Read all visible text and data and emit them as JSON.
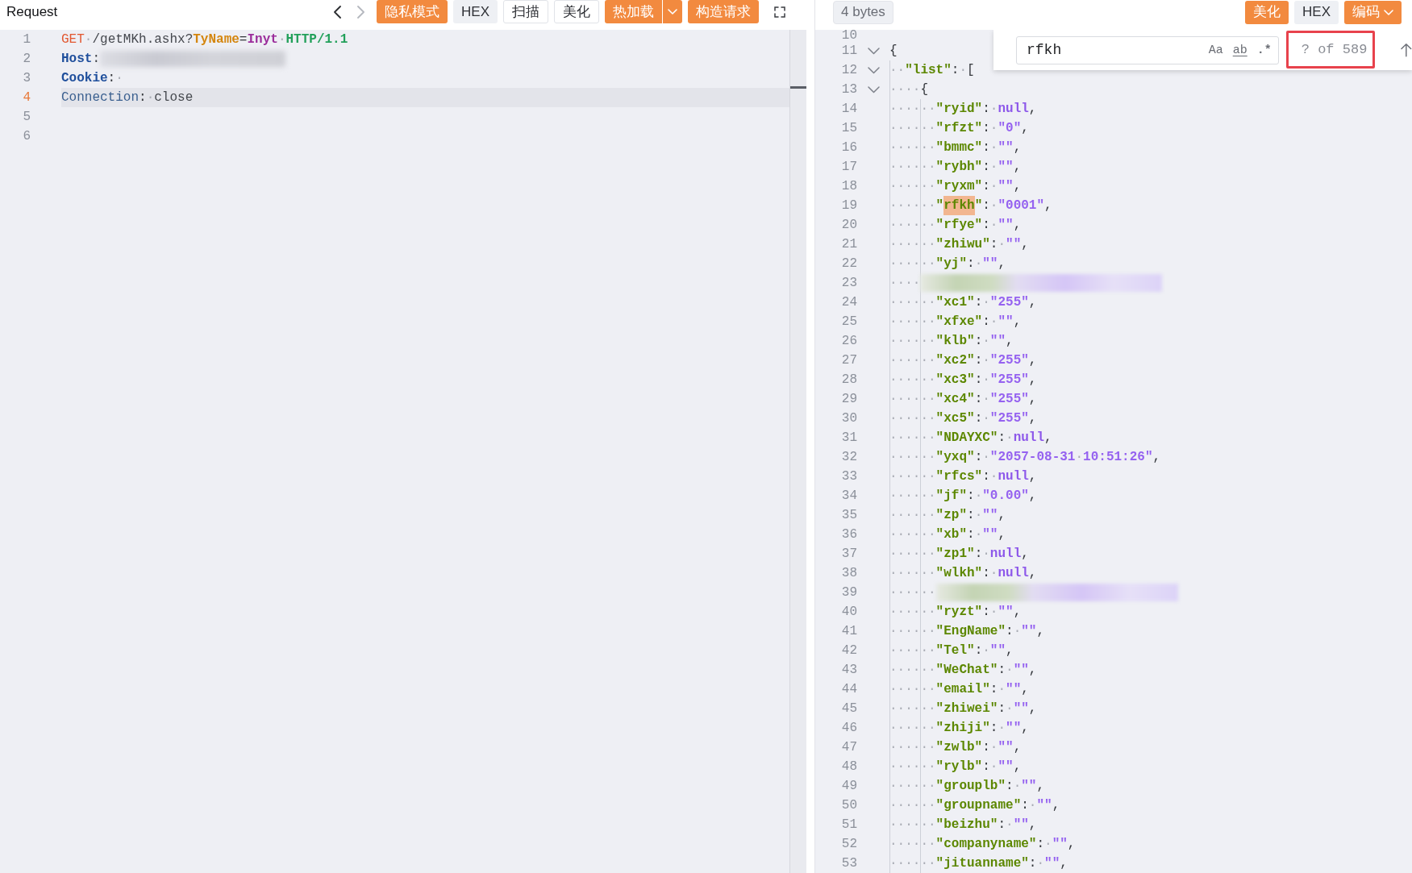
{
  "request": {
    "title": "Request",
    "history_nav": {
      "back_disabled": false,
      "forward_disabled": true
    },
    "toolbar": [
      {
        "label": "隐私模式",
        "kind": "primary",
        "dropdown": false
      },
      {
        "label": "HEX",
        "kind": "muted",
        "dropdown": false
      },
      {
        "label": "扫描",
        "kind": "outline",
        "dropdown": false
      },
      {
        "label": "美化",
        "kind": "outline",
        "dropdown": false
      },
      {
        "label": "热加载",
        "kind": "split",
        "dropdown": true
      },
      {
        "label": "构造请求",
        "kind": "primary",
        "dropdown": false
      }
    ],
    "lines": [
      {
        "number": "1",
        "current": false,
        "tokens": [
          {
            "kind": "method",
            "text": "GET"
          },
          {
            "kind": "ws",
            "text": "·"
          },
          {
            "kind": "path",
            "text": "/getMKh.ashx?"
          },
          {
            "kind": "param",
            "text": "TyName"
          },
          {
            "kind": "punct",
            "text": "="
          },
          {
            "kind": "value",
            "text": "Inyt"
          },
          {
            "kind": "ws",
            "text": "·"
          },
          {
            "kind": "version",
            "text": "HTTP/1.1"
          }
        ]
      },
      {
        "number": "2",
        "current": false,
        "tokens": [
          {
            "kind": "header",
            "text": "Host"
          },
          {
            "kind": "punct",
            "text": ":"
          },
          {
            "kind": "redacted"
          }
        ]
      },
      {
        "number": "3",
        "current": false,
        "tokens": [
          {
            "kind": "header",
            "text": "Cookie"
          },
          {
            "kind": "punct",
            "text": ":"
          },
          {
            "kind": "ws",
            "text": "·"
          }
        ]
      },
      {
        "number": "4",
        "current": true,
        "tokens": [
          {
            "kind": "name",
            "text": "Connection"
          },
          {
            "kind": "punct",
            "text": ":"
          },
          {
            "kind": "ws",
            "text": "·"
          },
          {
            "kind": "path",
            "text": "close"
          }
        ]
      },
      {
        "number": "5",
        "current": false
      },
      {
        "number": "6",
        "current": false
      }
    ]
  },
  "response": {
    "size_badge": "4 bytes",
    "toolbar": [
      {
        "label": "美化",
        "kind": "primary",
        "dropdown": false
      },
      {
        "label": "HEX",
        "kind": "muted",
        "dropdown": false
      },
      {
        "label": "编码",
        "kind": "primary",
        "dropdown": true
      }
    ],
    "find": {
      "query": "rfkh",
      "options": [
        {
          "kind": "case",
          "label": "Aa"
        },
        {
          "kind": "word",
          "label": "ab"
        },
        {
          "kind": "regex",
          "label": ".*"
        }
      ],
      "count": "? of 589",
      "count_boxed": true
    },
    "lines": [
      {
        "number": "10"
      },
      {
        "number": "11",
        "expanded": true,
        "tokens": [
          {
            "kind": "punct",
            "text": "{"
          }
        ]
      },
      {
        "number": "12",
        "expanded": true,
        "tokens": [
          {
            "kind": "ws",
            "text": "··"
          },
          {
            "kind": "key",
            "text": "\"list\""
          },
          {
            "kind": "punct",
            "text": ":"
          },
          {
            "kind": "ws",
            "text": "·"
          },
          {
            "kind": "punct",
            "text": "["
          }
        ]
      },
      {
        "number": "13",
        "expanded": true,
        "tokens": [
          {
            "kind": "ws",
            "text": "····"
          },
          {
            "kind": "punct",
            "text": "{"
          }
        ]
      },
      {
        "number": "14",
        "tokens": [
          {
            "kind": "ws",
            "text": "······"
          },
          {
            "kind": "key",
            "text": "\"ryid\""
          },
          {
            "kind": "punct",
            "text": ":"
          },
          {
            "kind": "ws",
            "text": "·"
          },
          {
            "kind": "null",
            "text": "null"
          },
          {
            "kind": "punct",
            "text": ","
          }
        ]
      },
      {
        "number": "15",
        "tokens": [
          {
            "kind": "ws",
            "text": "······"
          },
          {
            "kind": "key",
            "text": "\"rfzt\""
          },
          {
            "kind": "punct",
            "text": ":"
          },
          {
            "kind": "ws",
            "text": "·"
          },
          {
            "kind": "string",
            "text": "\"0\""
          },
          {
            "kind": "punct",
            "text": ","
          }
        ]
      },
      {
        "number": "16",
        "tokens": [
          {
            "kind": "ws",
            "text": "······"
          },
          {
            "kind": "key",
            "text": "\"bmmc\""
          },
          {
            "kind": "punct",
            "text": ":"
          },
          {
            "kind": "ws",
            "text": "·"
          },
          {
            "kind": "string",
            "text": "\"\""
          },
          {
            "kind": "punct",
            "text": ","
          }
        ]
      },
      {
        "number": "17",
        "tokens": [
          {
            "kind": "ws",
            "text": "······"
          },
          {
            "kind": "key",
            "text": "\"rybh\""
          },
          {
            "kind": "punct",
            "text": ":"
          },
          {
            "kind": "ws",
            "text": "·"
          },
          {
            "kind": "string",
            "text": "\"\""
          },
          {
            "kind": "punct",
            "text": ","
          }
        ]
      },
      {
        "number": "18",
        "tokens": [
          {
            "kind": "ws",
            "text": "······"
          },
          {
            "kind": "key",
            "text": "\"ryxm\""
          },
          {
            "kind": "punct",
            "text": ":"
          },
          {
            "kind": "ws",
            "text": "·"
          },
          {
            "kind": "string",
            "text": "\"\""
          },
          {
            "kind": "punct",
            "text": ","
          }
        ]
      },
      {
        "number": "19",
        "tokens": [
          {
            "kind": "ws",
            "text": "······"
          },
          {
            "kind": "key",
            "text": "\""
          },
          {
            "kind": "match",
            "text": "rfkh"
          },
          {
            "kind": "key",
            "text": "\""
          },
          {
            "kind": "punct",
            "text": ":"
          },
          {
            "kind": "ws",
            "text": "·"
          },
          {
            "kind": "string",
            "text": "\"0001\""
          },
          {
            "kind": "punct",
            "text": ","
          }
        ]
      },
      {
        "number": "20",
        "tokens": [
          {
            "kind": "ws",
            "text": "······"
          },
          {
            "kind": "key",
            "text": "\"rfye\""
          },
          {
            "kind": "punct",
            "text": ":"
          },
          {
            "kind": "ws",
            "text": "·"
          },
          {
            "kind": "string",
            "text": "\"\""
          },
          {
            "kind": "punct",
            "text": ","
          }
        ]
      },
      {
        "number": "21",
        "tokens": [
          {
            "kind": "ws",
            "text": "······"
          },
          {
            "kind": "key",
            "text": "\"zhiwu\""
          },
          {
            "kind": "punct",
            "text": ":"
          },
          {
            "kind": "ws",
            "text": "·"
          },
          {
            "kind": "string",
            "text": "\"\""
          },
          {
            "kind": "punct",
            "text": ","
          }
        ]
      },
      {
        "number": "22",
        "tokens": [
          {
            "kind": "ws",
            "text": "······"
          },
          {
            "kind": "key",
            "text": "\"yj\""
          },
          {
            "kind": "punct",
            "text": ":"
          },
          {
            "kind": "ws",
            "text": "·"
          },
          {
            "kind": "string",
            "text": "\"\""
          },
          {
            "kind": "punct",
            "text": ","
          }
        ]
      },
      {
        "number": "23",
        "tokens": [
          {
            "kind": "ws",
            "text": "····"
          },
          {
            "kind": "redacted"
          }
        ]
      },
      {
        "number": "24",
        "tokens": [
          {
            "kind": "ws",
            "text": "······"
          },
          {
            "kind": "key",
            "text": "\"xc1\""
          },
          {
            "kind": "punct",
            "text": ":"
          },
          {
            "kind": "ws",
            "text": "·"
          },
          {
            "kind": "string",
            "text": "\"255\""
          },
          {
            "kind": "punct",
            "text": ","
          }
        ]
      },
      {
        "number": "25",
        "tokens": [
          {
            "kind": "ws",
            "text": "······"
          },
          {
            "kind": "key",
            "text": "\"xfxe\""
          },
          {
            "kind": "punct",
            "text": ":"
          },
          {
            "kind": "ws",
            "text": "·"
          },
          {
            "kind": "string",
            "text": "\"\""
          },
          {
            "kind": "punct",
            "text": ","
          }
        ]
      },
      {
        "number": "26",
        "tokens": [
          {
            "kind": "ws",
            "text": "······"
          },
          {
            "kind": "key",
            "text": "\"klb\""
          },
          {
            "kind": "punct",
            "text": ":"
          },
          {
            "kind": "ws",
            "text": "·"
          },
          {
            "kind": "string",
            "text": "\"\""
          },
          {
            "kind": "punct",
            "text": ","
          }
        ]
      },
      {
        "number": "27",
        "tokens": [
          {
            "kind": "ws",
            "text": "······"
          },
          {
            "kind": "key",
            "text": "\"xc2\""
          },
          {
            "kind": "punct",
            "text": ":"
          },
          {
            "kind": "ws",
            "text": "·"
          },
          {
            "kind": "string",
            "text": "\"255\""
          },
          {
            "kind": "punct",
            "text": ","
          }
        ]
      },
      {
        "number": "28",
        "tokens": [
          {
            "kind": "ws",
            "text": "······"
          },
          {
            "kind": "key",
            "text": "\"xc3\""
          },
          {
            "kind": "punct",
            "text": ":"
          },
          {
            "kind": "ws",
            "text": "·"
          },
          {
            "kind": "string",
            "text": "\"255\""
          },
          {
            "kind": "punct",
            "text": ","
          }
        ]
      },
      {
        "number": "29",
        "tokens": [
          {
            "kind": "ws",
            "text": "······"
          },
          {
            "kind": "key",
            "text": "\"xc4\""
          },
          {
            "kind": "punct",
            "text": ":"
          },
          {
            "kind": "ws",
            "text": "·"
          },
          {
            "kind": "string",
            "text": "\"255\""
          },
          {
            "kind": "punct",
            "text": ","
          }
        ]
      },
      {
        "number": "30",
        "tokens": [
          {
            "kind": "ws",
            "text": "······"
          },
          {
            "kind": "key",
            "text": "\"xc5\""
          },
          {
            "kind": "punct",
            "text": ":"
          },
          {
            "kind": "ws",
            "text": "·"
          },
          {
            "kind": "string",
            "text": "\"255\""
          },
          {
            "kind": "punct",
            "text": ","
          }
        ]
      },
      {
        "number": "31",
        "tokens": [
          {
            "kind": "ws",
            "text": "······"
          },
          {
            "kind": "key",
            "text": "\"NDAYXC\""
          },
          {
            "kind": "punct",
            "text": ":"
          },
          {
            "kind": "ws",
            "text": "·"
          },
          {
            "kind": "null",
            "text": "null"
          },
          {
            "kind": "punct",
            "text": ","
          }
        ]
      },
      {
        "number": "32",
        "tokens": [
          {
            "kind": "ws",
            "text": "······"
          },
          {
            "kind": "key",
            "text": "\"yxq\""
          },
          {
            "kind": "punct",
            "text": ":"
          },
          {
            "kind": "ws",
            "text": "·"
          },
          {
            "kind": "string",
            "text": "\"2057-08-31"
          },
          {
            "kind": "ws",
            "text": "·"
          },
          {
            "kind": "string",
            "text": "10:51:26\""
          },
          {
            "kind": "punct",
            "text": ","
          }
        ]
      },
      {
        "number": "33",
        "tokens": [
          {
            "kind": "ws",
            "text": "······"
          },
          {
            "kind": "key",
            "text": "\"rfcs\""
          },
          {
            "kind": "punct",
            "text": ":"
          },
          {
            "kind": "ws",
            "text": "·"
          },
          {
            "kind": "null",
            "text": "null"
          },
          {
            "kind": "punct",
            "text": ","
          }
        ]
      },
      {
        "number": "34",
        "tokens": [
          {
            "kind": "ws",
            "text": "······"
          },
          {
            "kind": "key",
            "text": "\"jf\""
          },
          {
            "kind": "punct",
            "text": ":"
          },
          {
            "kind": "ws",
            "text": "·"
          },
          {
            "kind": "string",
            "text": "\"0.00\""
          },
          {
            "kind": "punct",
            "text": ","
          }
        ]
      },
      {
        "number": "35",
        "tokens": [
          {
            "kind": "ws",
            "text": "······"
          },
          {
            "kind": "key",
            "text": "\"zp\""
          },
          {
            "kind": "punct",
            "text": ":"
          },
          {
            "kind": "ws",
            "text": "·"
          },
          {
            "kind": "string",
            "text": "\"\""
          },
          {
            "kind": "punct",
            "text": ","
          }
        ]
      },
      {
        "number": "36",
        "tokens": [
          {
            "kind": "ws",
            "text": "······"
          },
          {
            "kind": "key",
            "text": "\"xb\""
          },
          {
            "kind": "punct",
            "text": ":"
          },
          {
            "kind": "ws",
            "text": "·"
          },
          {
            "kind": "string",
            "text": "\"\""
          },
          {
            "kind": "punct",
            "text": ","
          }
        ]
      },
      {
        "number": "37",
        "tokens": [
          {
            "kind": "ws",
            "text": "······"
          },
          {
            "kind": "key",
            "text": "\"zp1\""
          },
          {
            "kind": "punct",
            "text": ":"
          },
          {
            "kind": "ws",
            "text": "·"
          },
          {
            "kind": "null",
            "text": "null"
          },
          {
            "kind": "punct",
            "text": ","
          }
        ]
      },
      {
        "number": "38",
        "tokens": [
          {
            "kind": "ws",
            "text": "······"
          },
          {
            "kind": "key",
            "text": "\"wlkh\""
          },
          {
            "kind": "punct",
            "text": ":"
          },
          {
            "kind": "ws",
            "text": "·"
          },
          {
            "kind": "null",
            "text": "null"
          },
          {
            "kind": "punct",
            "text": ","
          }
        ]
      },
      {
        "number": "39",
        "tokens": [
          {
            "kind": "ws",
            "text": "······"
          },
          {
            "kind": "redacted"
          }
        ]
      },
      {
        "number": "40",
        "tokens": [
          {
            "kind": "ws",
            "text": "······"
          },
          {
            "kind": "key",
            "text": "\"ryzt\""
          },
          {
            "kind": "punct",
            "text": ":"
          },
          {
            "kind": "ws",
            "text": "·"
          },
          {
            "kind": "string",
            "text": "\"\""
          },
          {
            "kind": "punct",
            "text": ","
          }
        ]
      },
      {
        "number": "41",
        "tokens": [
          {
            "kind": "ws",
            "text": "······"
          },
          {
            "kind": "key",
            "text": "\"EngName\""
          },
          {
            "kind": "punct",
            "text": ":"
          },
          {
            "kind": "ws",
            "text": "·"
          },
          {
            "kind": "string",
            "text": "\"\""
          },
          {
            "kind": "punct",
            "text": ","
          }
        ]
      },
      {
        "number": "42",
        "tokens": [
          {
            "kind": "ws",
            "text": "······"
          },
          {
            "kind": "key",
            "text": "\"Tel\""
          },
          {
            "kind": "punct",
            "text": ":"
          },
          {
            "kind": "ws",
            "text": "·"
          },
          {
            "kind": "string",
            "text": "\"\""
          },
          {
            "kind": "punct",
            "text": ","
          }
        ]
      },
      {
        "number": "43",
        "tokens": [
          {
            "kind": "ws",
            "text": "······"
          },
          {
            "kind": "key",
            "text": "\"WeChat\""
          },
          {
            "kind": "punct",
            "text": ":"
          },
          {
            "kind": "ws",
            "text": "·"
          },
          {
            "kind": "string",
            "text": "\"\""
          },
          {
            "kind": "punct",
            "text": ","
          }
        ]
      },
      {
        "number": "44",
        "tokens": [
          {
            "kind": "ws",
            "text": "······"
          },
          {
            "kind": "key",
            "text": "\"email\""
          },
          {
            "kind": "punct",
            "text": ":"
          },
          {
            "kind": "ws",
            "text": "·"
          },
          {
            "kind": "string",
            "text": "\"\""
          },
          {
            "kind": "punct",
            "text": ","
          }
        ]
      },
      {
        "number": "45",
        "tokens": [
          {
            "kind": "ws",
            "text": "······"
          },
          {
            "kind": "key",
            "text": "\"zhiwei\""
          },
          {
            "kind": "punct",
            "text": ":"
          },
          {
            "kind": "ws",
            "text": "·"
          },
          {
            "kind": "string",
            "text": "\"\""
          },
          {
            "kind": "punct",
            "text": ","
          }
        ]
      },
      {
        "number": "46",
        "tokens": [
          {
            "kind": "ws",
            "text": "······"
          },
          {
            "kind": "key",
            "text": "\"zhiji\""
          },
          {
            "kind": "punct",
            "text": ":"
          },
          {
            "kind": "ws",
            "text": "·"
          },
          {
            "kind": "string",
            "text": "\"\""
          },
          {
            "kind": "punct",
            "text": ","
          }
        ]
      },
      {
        "number": "47",
        "tokens": [
          {
            "kind": "ws",
            "text": "······"
          },
          {
            "kind": "key",
            "text": "\"zwlb\""
          },
          {
            "kind": "punct",
            "text": ":"
          },
          {
            "kind": "ws",
            "text": "·"
          },
          {
            "kind": "string",
            "text": "\"\""
          },
          {
            "kind": "punct",
            "text": ","
          }
        ]
      },
      {
        "number": "48",
        "tokens": [
          {
            "kind": "ws",
            "text": "······"
          },
          {
            "kind": "key",
            "text": "\"rylb\""
          },
          {
            "kind": "punct",
            "text": ":"
          },
          {
            "kind": "ws",
            "text": "·"
          },
          {
            "kind": "string",
            "text": "\"\""
          },
          {
            "kind": "punct",
            "text": ","
          }
        ]
      },
      {
        "number": "49",
        "tokens": [
          {
            "kind": "ws",
            "text": "······"
          },
          {
            "kind": "key",
            "text": "\"grouplb\""
          },
          {
            "kind": "punct",
            "text": ":"
          },
          {
            "kind": "ws",
            "text": "·"
          },
          {
            "kind": "string",
            "text": "\"\""
          },
          {
            "kind": "punct",
            "text": ","
          }
        ]
      },
      {
        "number": "50",
        "tokens": [
          {
            "kind": "ws",
            "text": "······"
          },
          {
            "kind": "key",
            "text": "\"groupname\""
          },
          {
            "kind": "punct",
            "text": ":"
          },
          {
            "kind": "ws",
            "text": "·"
          },
          {
            "kind": "string",
            "text": "\"\""
          },
          {
            "kind": "punct",
            "text": ","
          }
        ]
      },
      {
        "number": "51",
        "tokens": [
          {
            "kind": "ws",
            "text": "······"
          },
          {
            "kind": "key",
            "text": "\"beizhu\""
          },
          {
            "kind": "punct",
            "text": ":"
          },
          {
            "kind": "ws",
            "text": "·"
          },
          {
            "kind": "string",
            "text": "\"\""
          },
          {
            "kind": "punct",
            "text": ","
          }
        ]
      },
      {
        "number": "52",
        "tokens": [
          {
            "kind": "ws",
            "text": "······"
          },
          {
            "kind": "key",
            "text": "\"companyname\""
          },
          {
            "kind": "punct",
            "text": ":"
          },
          {
            "kind": "ws",
            "text": "·"
          },
          {
            "kind": "string",
            "text": "\"\""
          },
          {
            "kind": "punct",
            "text": ","
          }
        ]
      },
      {
        "number": "53",
        "tokens": [
          {
            "kind": "ws",
            "text": "······"
          },
          {
            "kind": "key",
            "text": "\"jituanname\""
          },
          {
            "kind": "punct",
            "text": ":"
          },
          {
            "kind": "ws",
            "text": "·"
          },
          {
            "kind": "string",
            "text": "\"\""
          },
          {
            "kind": "punct",
            "text": ","
          }
        ]
      }
    ]
  }
}
